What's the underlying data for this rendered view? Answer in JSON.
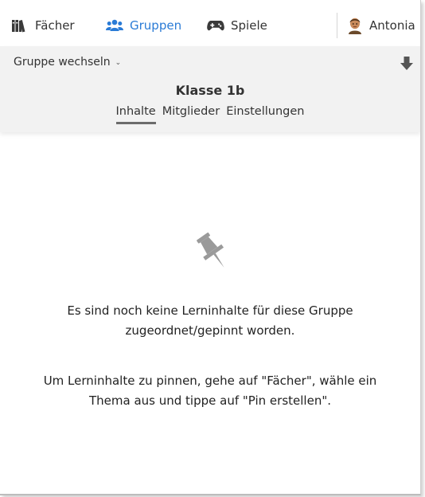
{
  "nav": {
    "faecher": {
      "label": "Fächer",
      "icon": "books-icon"
    },
    "gruppen": {
      "label": "Gruppen",
      "icon": "users-icon",
      "active": true
    },
    "spiele": {
      "label": "Spiele",
      "icon": "gamepad-icon"
    },
    "user": {
      "name": "Antonia",
      "icon": "avatar-icon"
    }
  },
  "group_bar": {
    "switch_label": "Gruppe wechseln",
    "title": "Klasse 1b",
    "tabs": [
      "Inhalte",
      "Mitglieder",
      "Einstellungen"
    ],
    "active_tab": "Inhalte"
  },
  "empty_state": {
    "icon": "pin-icon",
    "line1": "Es sind noch keine Lerninhalte für diese Gruppe",
    "line2": "zugeordnet/gepinnt worden.",
    "line3": "Um Lerninhalte zu pinnen, gehe auf \"Fächer\", wähle ein",
    "line4": "Thema aus und tippe auf \"Pin erstellen\"."
  },
  "colors": {
    "accent": "#2a7bd6",
    "subheader_bg": "#f2f2f2",
    "icon_grey": "#9a9a9a"
  }
}
